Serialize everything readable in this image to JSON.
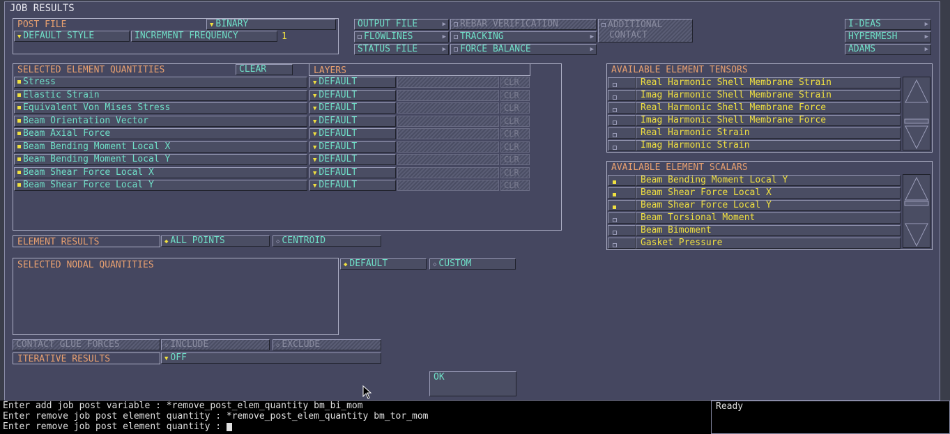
{
  "title": "JOB RESULTS",
  "post_file": {
    "label": "POST FILE",
    "format": "BINARY",
    "style": "DEFAULT STYLE",
    "increment_label": "INCREMENT FREQUENCY",
    "increment_value": "1"
  },
  "output_buttons": {
    "output_file": "OUTPUT FILE",
    "flowlines": "FLOWLINES",
    "status_file": "STATUS FILE",
    "rebar": "REBAR VERIFICATION",
    "tracking": "TRACKING",
    "force_balance": "FORCE BALANCE",
    "additional_contact_1": "ADDITIONAL",
    "additional_contact_2": "CONTACT"
  },
  "export_buttons": {
    "ideas": "I-DEAS",
    "hypermesh": "HYPERMESH",
    "adams": "ADAMS"
  },
  "selected_elements": {
    "header": "SELECTED ELEMENT QUANTITIES",
    "clear": "CLEAR",
    "layers_header": "LAYERS",
    "rows": [
      {
        "name": "Stress",
        "layer": "DEFAULT",
        "clr": "CLR"
      },
      {
        "name": "Elastic Strain",
        "layer": "DEFAULT",
        "clr": "CLR"
      },
      {
        "name": "Equivalent Von Mises Stress",
        "layer": "DEFAULT",
        "clr": "CLR"
      },
      {
        "name": "Beam Orientation Vector",
        "layer": "DEFAULT",
        "clr": "CLR"
      },
      {
        "name": "Beam Axial Force",
        "layer": "DEFAULT",
        "clr": "CLR"
      },
      {
        "name": "Beam Bending Moment Local X",
        "layer": "DEFAULT",
        "clr": "CLR"
      },
      {
        "name": "Beam Bending Moment Local Y",
        "layer": "DEFAULT",
        "clr": "CLR"
      },
      {
        "name": "Beam Shear Force Local X",
        "layer": "DEFAULT",
        "clr": "CLR"
      },
      {
        "name": "Beam Shear Force Local Y",
        "layer": "DEFAULT",
        "clr": "CLR"
      }
    ]
  },
  "tensors": {
    "header": "AVAILABLE ELEMENT TENSORS",
    "rows": [
      {
        "name": "Real Harmonic Shell Membrane Strain",
        "checked": false
      },
      {
        "name": "Imag Harmonic Shell Membrane Strain",
        "checked": false
      },
      {
        "name": "Real Harmonic Shell Membrane Force",
        "checked": false
      },
      {
        "name": "Imag Harmonic Shell Membrane Force",
        "checked": false
      },
      {
        "name": "Real Harmonic Strain",
        "checked": false
      },
      {
        "name": "Imag Harmonic Strain",
        "checked": false
      }
    ]
  },
  "scalars": {
    "header": "AVAILABLE ELEMENT SCALARS",
    "rows": [
      {
        "name": "Beam Bending Moment Local Y",
        "checked": true
      },
      {
        "name": "Beam Shear Force Local X",
        "checked": true
      },
      {
        "name": "Beam Shear Force Local Y",
        "checked": true
      },
      {
        "name": "Beam Torsional Moment",
        "checked": false
      },
      {
        "name": "Beam Bimoment",
        "checked": false
      },
      {
        "name": "Gasket Pressure",
        "checked": false
      }
    ]
  },
  "element_results": {
    "label": "ELEMENT RESULTS",
    "all_points": "ALL POINTS",
    "centroid": "CENTROID"
  },
  "nodal": {
    "header": "SELECTED NODAL QUANTITIES",
    "default": "DEFAULT",
    "custom": "CUSTOM"
  },
  "contact_glue": {
    "label": "CONTACT GLUE FORCES",
    "include": "INCLUDE",
    "exclude": "EXCLUDE"
  },
  "iterative": {
    "label": "ITERATIVE RESULTS",
    "value": "OFF"
  },
  "ok": "OK",
  "console": [
    "Enter add job post variable : *remove_post_elem_quantity bm_bi_mom",
    "Enter remove job post element quantity : *remove_post_elem_quantity bm_tor_mom",
    "Enter remove job post element quantity : "
  ],
  "status": "Ready"
}
